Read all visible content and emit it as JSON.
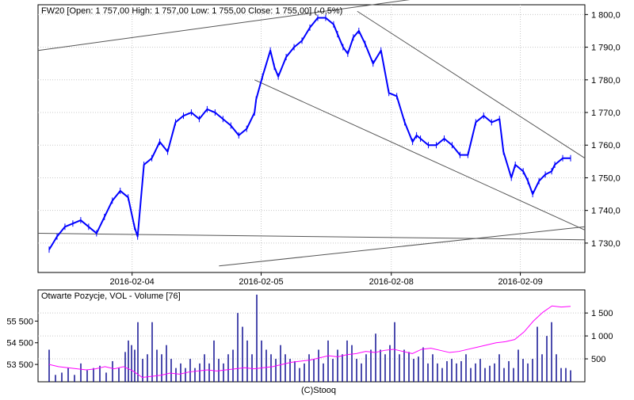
{
  "main_panel": {
    "title": "FW20 [Open: 1 757,00  High: 1 757,00  Low: 1 755,00  Close: 1 755,00] (-0,5%)",
    "y_ticks": [
      "1 730,0",
      "1 740,0",
      "1 750,0",
      "1 760,0",
      "1 770,0",
      "1 780,0",
      "1 790,0",
      "1 800,0"
    ],
    "x_ticks": [
      "2016-02-04",
      "2016-02-05",
      "2016-02-08",
      "2016-02-09"
    ]
  },
  "volume_panel": {
    "title": "Otwarte Pozycje, VOL - Volume [76]",
    "left_ticks": [
      "53 500",
      "54 500",
      "55 500"
    ],
    "right_ticks": [
      "500",
      "1 000",
      "1 500"
    ]
  },
  "footer": {
    "credit": "(C)Stooq"
  },
  "colors": {
    "price": "#0000ff",
    "volume": "#00008b",
    "open_interest": "#ff00ff",
    "trendline": "#000000",
    "frame": "#000000"
  },
  "chart_data": [
    {
      "type": "line",
      "title": "FW20 [Open: 1 757,00  High: 1 757,00  Low: 1 755,00  Close: 1 755,00] (-0,5%)",
      "ylim": [
        1721,
        1803
      ],
      "x": [
        0,
        10,
        20,
        30,
        40,
        50,
        60,
        70,
        80,
        90,
        100,
        108,
        112,
        120,
        130,
        140,
        150,
        160,
        170,
        180,
        190,
        200,
        210,
        220,
        230,
        240,
        250,
        260,
        262,
        270,
        280,
        285,
        290,
        300,
        310,
        320,
        330,
        340,
        350,
        360,
        365,
        372,
        378,
        385,
        392,
        400,
        410,
        420,
        430,
        440,
        450,
        460,
        465,
        470,
        480,
        490,
        500,
        510,
        520,
        530,
        540,
        550,
        560,
        570,
        575,
        585,
        590,
        600,
        606,
        612,
        620,
        628,
        636,
        640,
        650,
        660
      ],
      "series": [
        {
          "values": [
            1728,
            1732,
            1735,
            1736,
            1737,
            1735,
            1733,
            1738,
            1743,
            1746,
            1744,
            1735,
            1732,
            1754,
            1756,
            1761,
            1758,
            1767,
            1769,
            1770,
            1768,
            1771,
            1770,
            1768,
            1766,
            1763,
            1765,
            1770,
            1774,
            1781,
            1789,
            1784,
            1781,
            1787,
            1790,
            1792,
            1796,
            1799,
            1799,
            1797,
            1794,
            1790,
            1788,
            1793,
            1795,
            1791,
            1785,
            1789,
            1776,
            1775,
            1767,
            1761,
            1763,
            1762,
            1760,
            1760,
            1762,
            1760,
            1757,
            1757,
            1767,
            1769,
            1767,
            1768,
            1758,
            1750,
            1754,
            1752,
            1749,
            1745,
            1749,
            1751,
            1752,
            1754,
            1756,
            1756
          ]
        }
      ]
    },
    {
      "type": "bar",
      "title": "Otwarte Pozycje, VOL - Volume [76]",
      "ylim": [
        0,
        1900
      ],
      "x": [
        0,
        8,
        16,
        24,
        32,
        40,
        48,
        56,
        64,
        72,
        80,
        88,
        96,
        100,
        104,
        108,
        112,
        118,
        124,
        130,
        136,
        142,
        148,
        154,
        160,
        166,
        172,
        178,
        184,
        190,
        196,
        202,
        208,
        214,
        220,
        226,
        232,
        238,
        244,
        250,
        256,
        262,
        268,
        274,
        280,
        286,
        292,
        298,
        304,
        310,
        316,
        322,
        328,
        334,
        340,
        346,
        352,
        358,
        364,
        370,
        376,
        382,
        388,
        394,
        400,
        406,
        412,
        418,
        424,
        430,
        436,
        442,
        448,
        454,
        460,
        466,
        472,
        478,
        484,
        490,
        496,
        502,
        508,
        514,
        520,
        526,
        532,
        538,
        544,
        550,
        556,
        562,
        568,
        574,
        580,
        586,
        592,
        598,
        604,
        610,
        616,
        622,
        628,
        634,
        640,
        646,
        652,
        658
      ],
      "series": [
        {
          "name": "Volume",
          "values": [
            700,
            150,
            200,
            300,
            150,
            400,
            250,
            300,
            350,
            200,
            450,
            300,
            650,
            900,
            800,
            700,
            1300,
            500,
            600,
            1300,
            700,
            600,
            800,
            500,
            300,
            400,
            300,
            500,
            300,
            400,
            600,
            400,
            900,
            500,
            400,
            600,
            700,
            1500,
            1200,
            900,
            600,
            1900,
            900,
            700,
            600,
            500,
            800,
            600,
            500,
            450,
            300,
            400,
            600,
            500,
            700,
            400,
            900,
            500,
            700,
            600,
            900,
            800,
            500,
            400,
            600,
            700,
            1050,
            700,
            600,
            800,
            1300,
            600,
            700,
            650,
            500,
            550,
            750,
            400,
            600,
            400,
            300,
            450,
            500,
            400,
            450,
            600,
            300,
            400,
            500,
            300,
            350,
            400,
            600,
            300,
            450,
            300,
            700,
            500,
            400,
            500,
            1200,
            600,
            1000,
            1300,
            600,
            300,
            300,
            250
          ]
        },
        {
          "name": "Otwarte Pozycje",
          "values": [
            53500,
            53400,
            53350,
            53300,
            53250,
            53300,
            53400,
            53300,
            53400,
            53200,
            52900,
            52950,
            53000,
            53100,
            53050,
            53150,
            53200,
            53250,
            53200,
            53250,
            53300,
            53350,
            53300,
            53350,
            53400,
            53500,
            53600,
            53650,
            53700,
            53800,
            53900,
            53850,
            53950,
            54000,
            54100,
            54050,
            54150,
            54200,
            54100,
            54000,
            54200,
            54250,
            54150,
            54050,
            54100,
            54200,
            54300,
            54400,
            54500,
            54550,
            54650,
            55000,
            55500,
            55900,
            56200,
            56150,
            56180
          ]
        }
      ]
    }
  ]
}
